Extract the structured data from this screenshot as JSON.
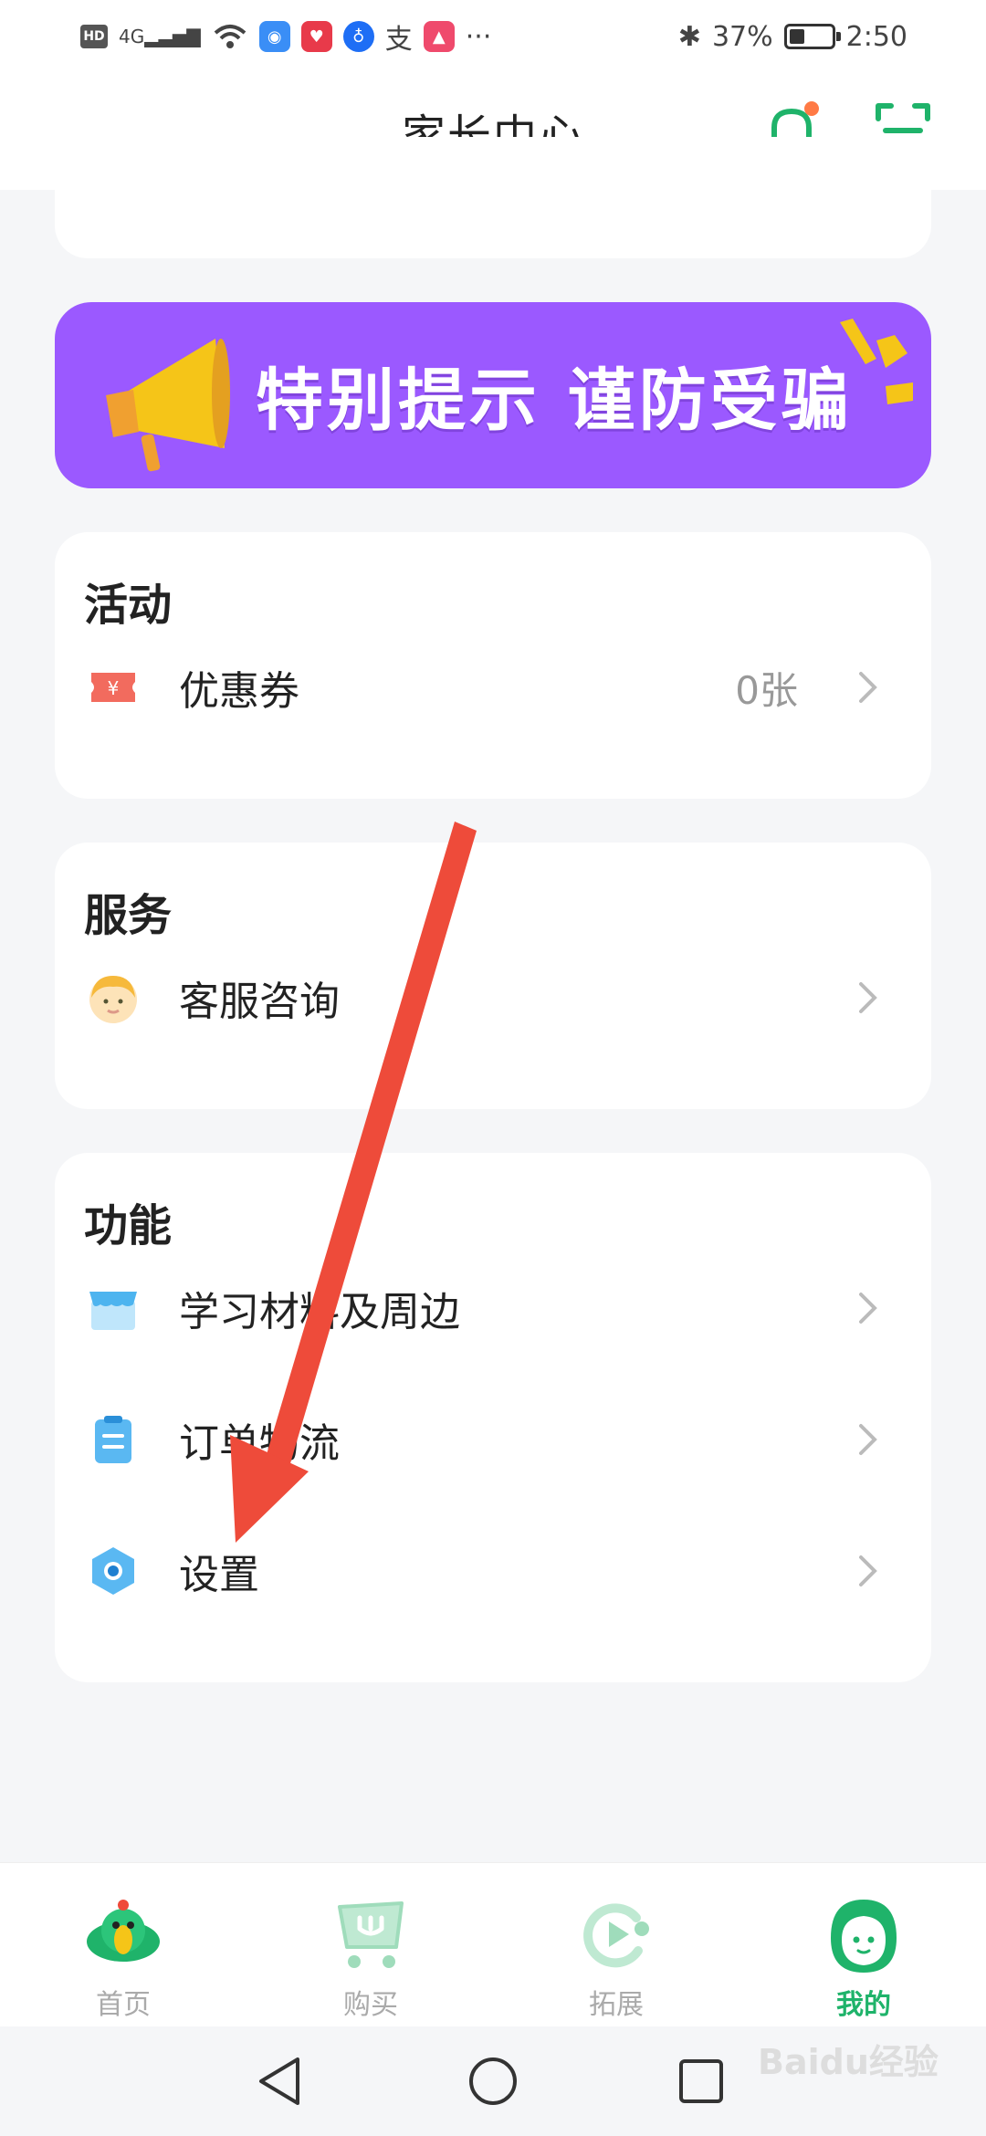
{
  "status_bar": {
    "left_icons": [
      "hd-icon",
      "4g-signal-icon",
      "wifi-icon",
      "app-blue-icon",
      "app-red-icon",
      "app-bulb-icon",
      "alipay-icon",
      "app-cap-icon"
    ],
    "more": "···",
    "battery_percent": "37%",
    "time": "2:50"
  },
  "header": {
    "title": "家长中心",
    "bell_dot_color": "#ff7a45",
    "accent": "#1fb36a"
  },
  "banner": {
    "text": "特别提示 谨防受骗",
    "bg_color": "#9b59ff"
  },
  "activity": {
    "title": "活动",
    "items": [
      {
        "label": "优惠券",
        "value": "0张",
        "icon": "coupon-icon"
      }
    ]
  },
  "service": {
    "title": "服务",
    "items": [
      {
        "label": "客服咨询",
        "icon": "customer-service-avatar-icon"
      }
    ]
  },
  "function": {
    "title": "功能",
    "items": [
      {
        "label": "学习材料及周边",
        "icon": "store-icon"
      },
      {
        "label": "订单物流",
        "icon": "clipboard-icon"
      },
      {
        "label": "设置",
        "icon": "settings-hexagon-icon"
      }
    ]
  },
  "bottom_nav": {
    "items": [
      {
        "label": "首页",
        "icon": "parrot-home-icon"
      },
      {
        "label": "购买",
        "icon": "cart-icon"
      },
      {
        "label": "拓展",
        "icon": "expand-play-icon"
      },
      {
        "label": "我的",
        "icon": "profile-icon"
      }
    ],
    "active_index": 3
  },
  "system_nav": {
    "buttons": [
      "back-triangle-icon",
      "home-circle-icon",
      "recent-square-icon"
    ]
  },
  "watermark": "Baidu经验"
}
